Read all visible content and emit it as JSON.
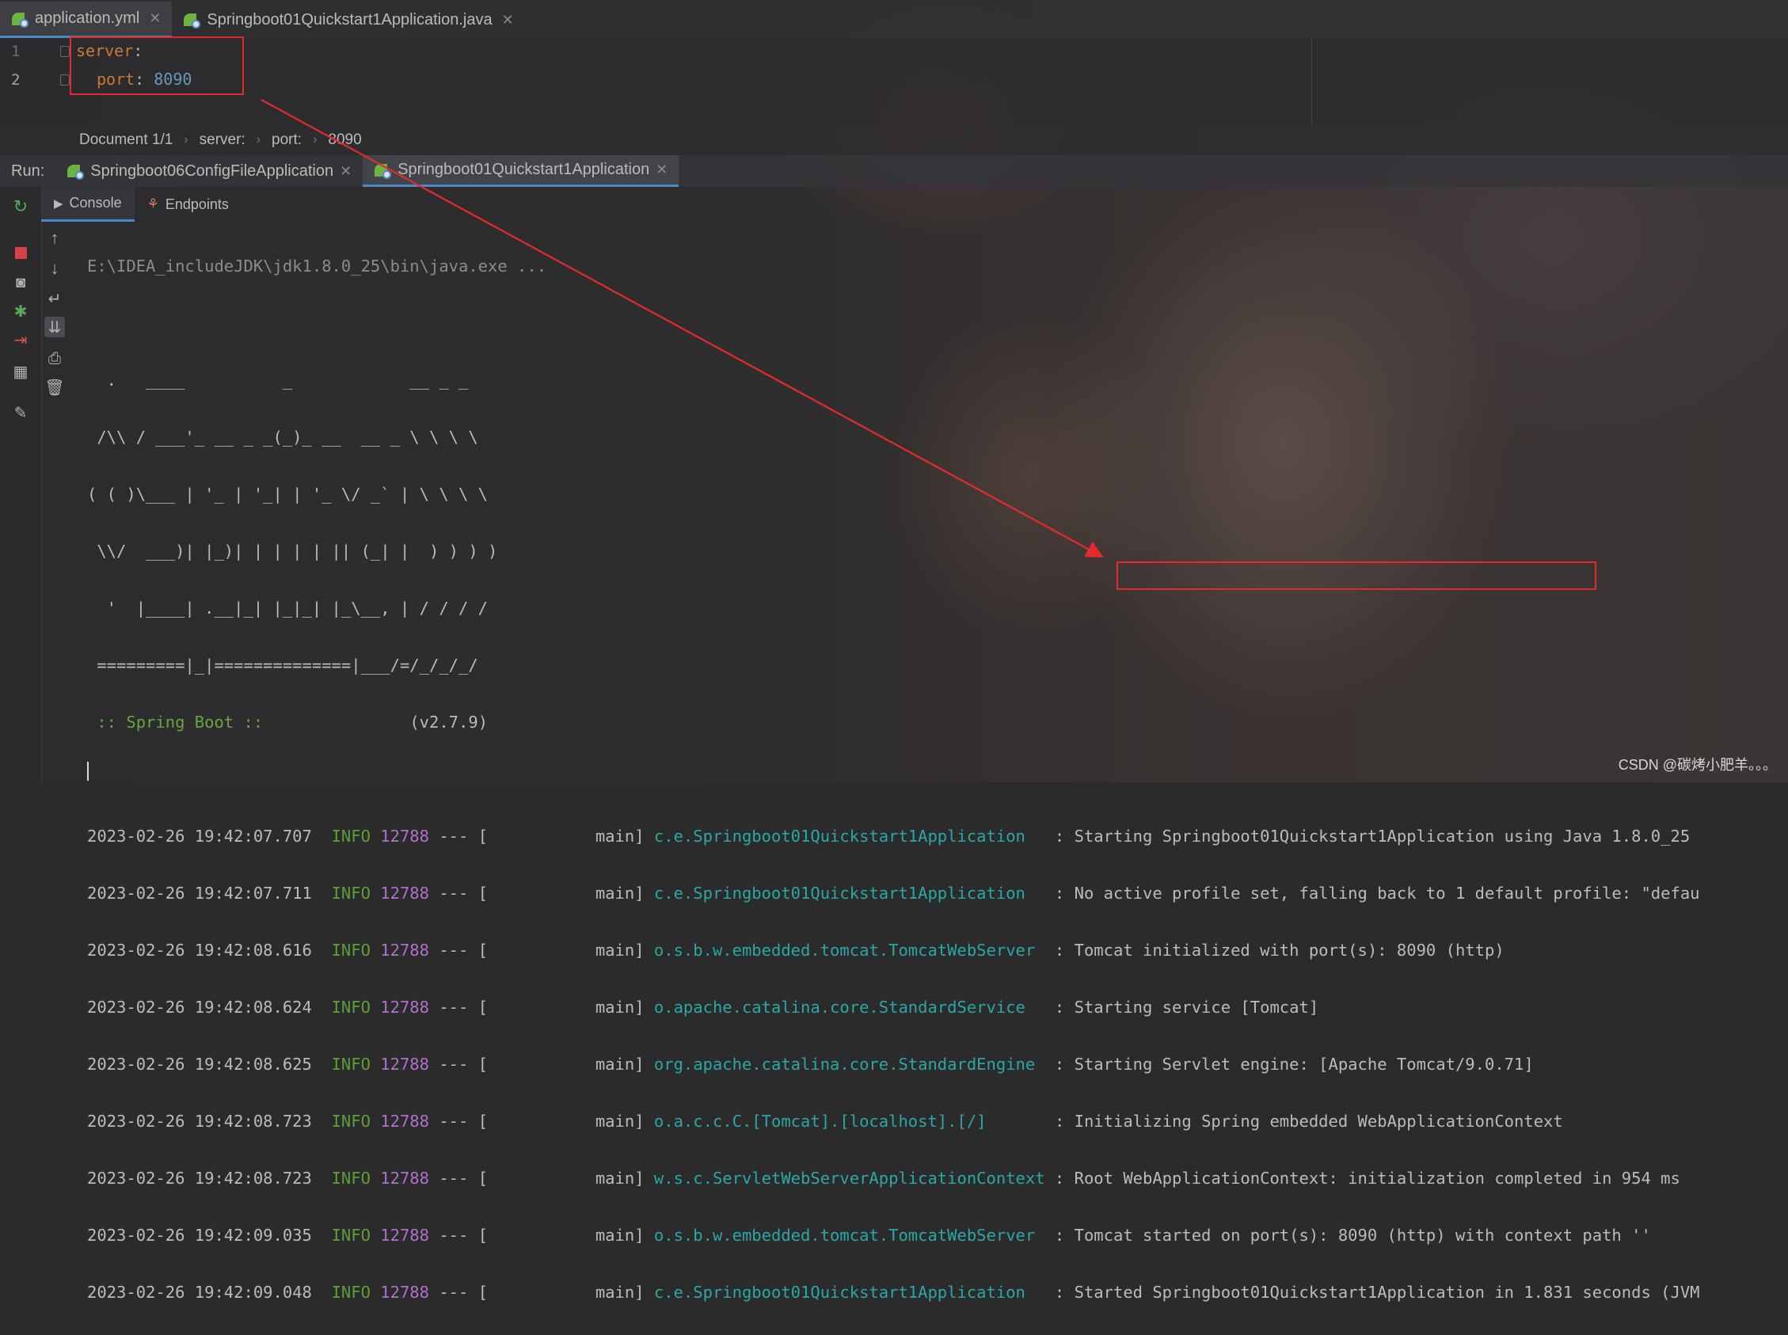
{
  "editor_tabs": [
    {
      "label": "application.yml",
      "active": true
    },
    {
      "label": "Springboot01Quickstart1Application.java",
      "active": false
    }
  ],
  "editor": {
    "lines": [
      {
        "number": "1",
        "key": "server",
        "sep": ":",
        "value": ""
      },
      {
        "number": "2",
        "key": "port",
        "sep": ":",
        "value": "8090"
      }
    ]
  },
  "breadcrumb": [
    "Document 1/1",
    "server:",
    "port:",
    "8090"
  ],
  "run": {
    "label": "Run:",
    "tabs": [
      {
        "label": "Springboot06ConfigFileApplication",
        "active": false
      },
      {
        "label": "Springboot01Quickstart1Application",
        "active": true
      }
    ],
    "subtabs": [
      "Console",
      "Endpoints"
    ]
  },
  "console": {
    "command": "E:\\IDEA_includeJDK\\jdk1.8.0_25\\bin\\java.exe ...",
    "banner": [
      "  .   ____          _            __ _ _",
      " /\\\\ / ___'_ __ _ _(_)_ __  __ _ \\ \\ \\ \\",
      "( ( )\\___ | '_ | '_| | '_ \\/ _` | \\ \\ \\ \\",
      " \\\\/  ___)| |_)| | | | | || (_| |  ) ) ) )",
      "  '  |____| .__|_| |_|_| |_\\__, | / / / /",
      " =========|_|==============|___/=/_/_/_/"
    ],
    "spring_boot_label": " :: Spring Boot ::",
    "spring_boot_version": "(v2.7.9)",
    "logs": [
      {
        "ts": "2023-02-26 19:42:07.707",
        "level": "INFO",
        "pid": "12788",
        "sep": "--- [",
        "thread": "main]",
        "logger": "c.e.Springboot01Quickstart1Application",
        "msg": ": Starting Springboot01Quickstart1Application using Java 1.8.0_25"
      },
      {
        "ts": "2023-02-26 19:42:07.711",
        "level": "INFO",
        "pid": "12788",
        "sep": "--- [",
        "thread": "main]",
        "logger": "c.e.Springboot01Quickstart1Application",
        "msg": ": No active profile set, falling back to 1 default profile: \"defau"
      },
      {
        "ts": "2023-02-26 19:42:08.616",
        "level": "INFO",
        "pid": "12788",
        "sep": "--- [",
        "thread": "main]",
        "logger": "o.s.b.w.embedded.tomcat.TomcatWebServer",
        "msg": ": Tomcat initialized with port(s): 8090 (http)"
      },
      {
        "ts": "2023-02-26 19:42:08.624",
        "level": "INFO",
        "pid": "12788",
        "sep": "--- [",
        "thread": "main]",
        "logger": "o.apache.catalina.core.StandardService",
        "msg": ": Starting service [Tomcat]"
      },
      {
        "ts": "2023-02-26 19:42:08.625",
        "level": "INFO",
        "pid": "12788",
        "sep": "--- [",
        "thread": "main]",
        "logger": "org.apache.catalina.core.StandardEngine",
        "msg": ": Starting Servlet engine: [Apache Tomcat/9.0.71]"
      },
      {
        "ts": "2023-02-26 19:42:08.723",
        "level": "INFO",
        "pid": "12788",
        "sep": "--- [",
        "thread": "main]",
        "logger": "o.a.c.c.C.[Tomcat].[localhost].[/]",
        "msg": ": Initializing Spring embedded WebApplicationContext"
      },
      {
        "ts": "2023-02-26 19:42:08.723",
        "level": "INFO",
        "pid": "12788",
        "sep": "--- [",
        "thread": "main]",
        "logger": "w.s.c.ServletWebServerApplicationContext",
        "msg": ": Root WebApplicationContext: initialization completed in 954 ms"
      },
      {
        "ts": "2023-02-26 19:42:09.035",
        "level": "INFO",
        "pid": "12788",
        "sep": "--- [",
        "thread": "main]",
        "logger": "o.s.b.w.embedded.tomcat.TomcatWebServer",
        "msg": ": Tomcat started on port(s): 8090 (http) with context path ''"
      },
      {
        "ts": "2023-02-26 19:42:09.048",
        "level": "INFO",
        "pid": "12788",
        "sep": "--- [",
        "thread": "main]",
        "logger": "c.e.Springboot01Quickstart1Application",
        "msg": ": Started Springboot01Quickstart1Application in 1.831 seconds (JVM"
      }
    ]
  },
  "watermark": "CSDN @碳烤小肥羊。。。",
  "colors": {
    "accent": "#4a88c7",
    "annotation": "#e32b2b",
    "spring_green": "#6db33f"
  },
  "icons": {
    "left_toolbar": [
      "rerun-icon",
      "stop-icon",
      "camera-icon",
      "debug-settings-icon",
      "exit-icon",
      "layout-icon",
      "pin-icon"
    ],
    "console_toolbar": [
      "up-arrow-icon",
      "down-arrow-icon",
      "soft-wrap-icon",
      "scroll-to-end-icon",
      "print-icon",
      "trash-icon"
    ]
  }
}
